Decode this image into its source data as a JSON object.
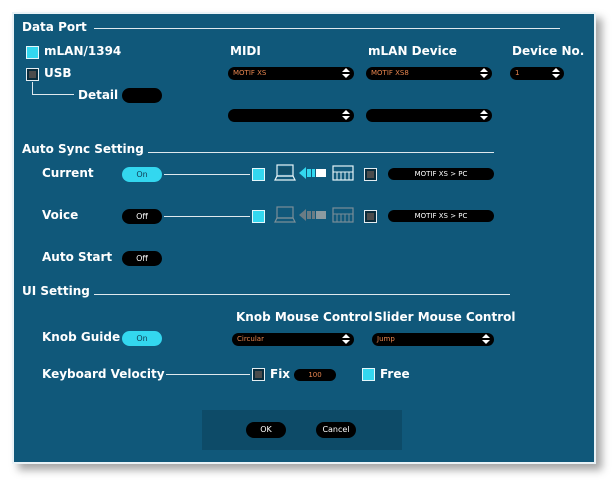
{
  "data_port": {
    "title": "Data Port",
    "mlan_label": "mLAN/1394",
    "usb_label": "USB",
    "detail_label": "Detail",
    "col_midi": "MIDI",
    "col_mlan_device": "mLAN Device",
    "col_device_no": "Device No.",
    "midi_value": "MOTIF XS",
    "mlan_device_value": "MOTIF XS8",
    "device_no_value": "1",
    "midi_value_2": "",
    "mlan_device_value_2": ""
  },
  "auto_sync": {
    "title": "Auto Sync Setting",
    "current_label": "Current",
    "current_state": "On",
    "current_route": "MOTIF XS > PC",
    "voice_label": "Voice",
    "voice_state": "Off",
    "voice_route": "MOTIF XS > PC",
    "auto_start_label": "Auto Start",
    "auto_start_state": "Off"
  },
  "ui_setting": {
    "title": "UI Setting",
    "knob_mouse_label": "Knob Mouse Control",
    "knob_mouse_value": "Circular",
    "slider_mouse_label": "Slider Mouse Control",
    "slider_mouse_value": "Jump",
    "knob_guide_label": "Knob Guide",
    "knob_guide_state": "On",
    "keyboard_velocity_label": "Keyboard Velocity",
    "fix_label": "Fix",
    "fix_value": "100",
    "free_label": "Free"
  },
  "buttons": {
    "ok": "OK",
    "cancel": "Cancel"
  },
  "colors": {
    "panel": "#10587a",
    "accent": "#33d7ef",
    "value_text": "#e7854f"
  }
}
